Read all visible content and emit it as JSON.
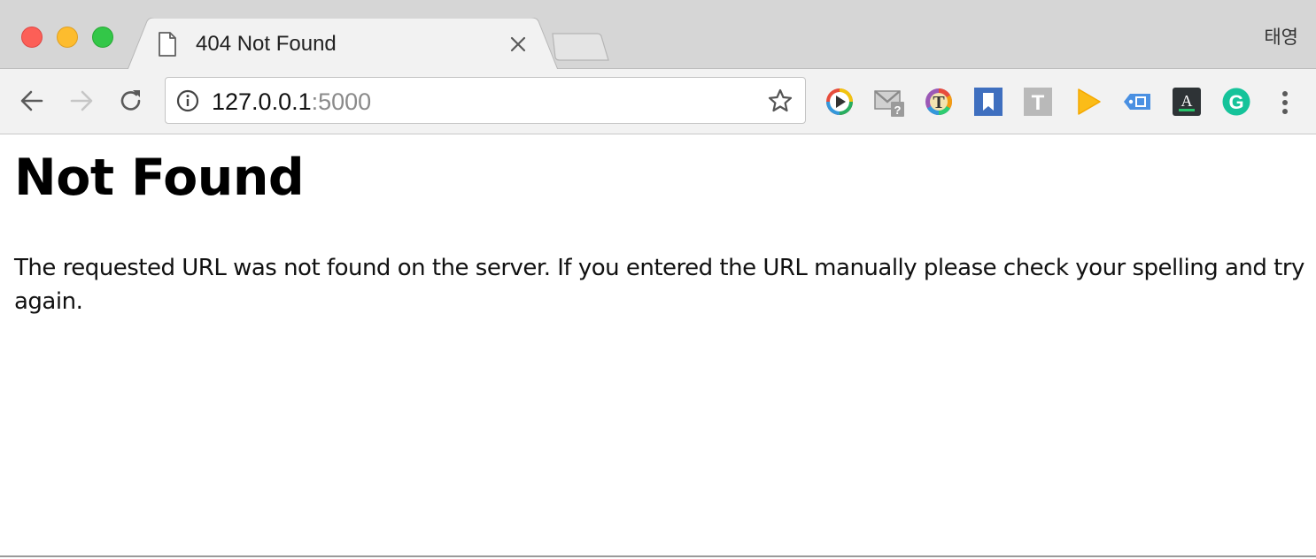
{
  "browser": {
    "tab": {
      "title": "404 Not Found"
    },
    "profile_name": "태영",
    "address_bar": {
      "host": "127.0.0.1",
      "port": ":5000"
    },
    "extensions": [
      {
        "name": "media-player-extension-icon"
      },
      {
        "name": "gmail-checker-extension-icon",
        "badge": "?"
      },
      {
        "name": "rainbow-t-extension-icon",
        "label": "T"
      },
      {
        "name": "bookmark-extension-icon"
      },
      {
        "name": "grey-t-extension-icon",
        "label": "T"
      },
      {
        "name": "play-extension-icon"
      },
      {
        "name": "tag-extension-icon"
      },
      {
        "name": "font-extension-icon",
        "label": "A"
      },
      {
        "name": "grammarly-extension-icon",
        "label": "G"
      }
    ]
  },
  "page": {
    "heading": "Not Found",
    "message": "The requested URL was not found on the server. If you entered the URL manually please check your spelling and try again."
  },
  "colors": {
    "close_button": "#fc5f57",
    "minimize_button": "#fdbc2e",
    "maximize_button": "#33c748",
    "toolbar_bg": "#f2f2f2",
    "tabstrip_bg": "#d6d6d6",
    "url_port": "#8a8a8a"
  }
}
